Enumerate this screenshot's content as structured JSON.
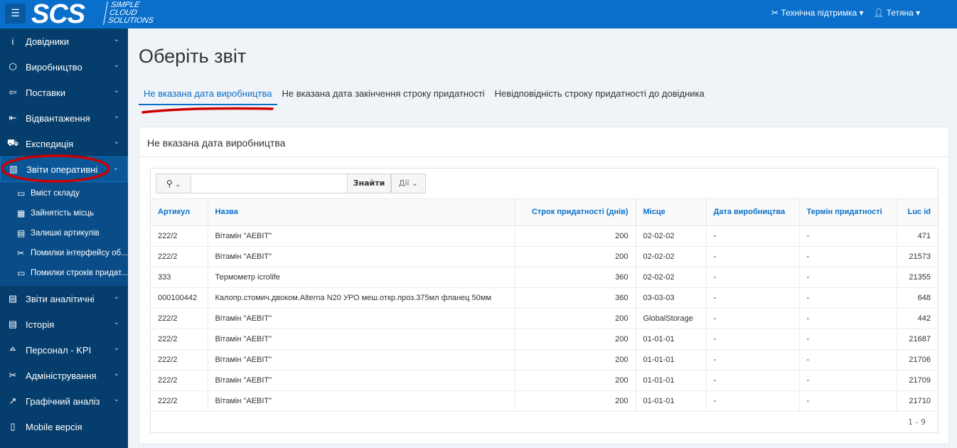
{
  "header": {
    "logo": "SCS",
    "logo_sub": [
      "SIMPLE",
      "CLOUD",
      "SOLUTIONS"
    ],
    "support": "Технічна підтримка",
    "user": "Тетяна"
  },
  "sidebar": {
    "items": [
      {
        "label": "Довідники",
        "icon": "info-icon"
      },
      {
        "label": "Виробництво",
        "icon": "box-icon"
      },
      {
        "label": "Поставки",
        "icon": "sign-in-icon"
      },
      {
        "label": "Відвантаження",
        "icon": "sign-out-icon"
      },
      {
        "label": "Експедиція",
        "icon": "truck-icon"
      },
      {
        "label": "Звіти оперативні",
        "icon": "bar-chart-icon",
        "active": true
      }
    ],
    "subitems": [
      {
        "label": "Вміст складу",
        "icon": "window-icon"
      },
      {
        "label": "Зайнятість місць",
        "icon": "grid-icon"
      },
      {
        "label": "Залишкі артикулів",
        "icon": "archive-icon"
      },
      {
        "label": "Помилки інтерфейсу об...",
        "icon": "tools-icon"
      },
      {
        "label": "Помилки строків придат...",
        "icon": "calendar-x-icon"
      }
    ],
    "items2": [
      {
        "label": "Звіти аналітичні",
        "icon": "report-icon"
      },
      {
        "label": "Історія",
        "icon": "archive-icon"
      },
      {
        "label": "Персонал - KPI",
        "icon": "people-icon"
      },
      {
        "label": "Адміністрування",
        "icon": "tools-icon"
      },
      {
        "label": "Графічний аналіз",
        "icon": "chart-icon"
      },
      {
        "label": "Mobile версія",
        "icon": "mobile-icon"
      }
    ]
  },
  "page": {
    "title": "Оберіть звіт",
    "tabs": [
      "Не вказана дата виробництва",
      "Не вказана дата закінчення строку придатності",
      "Невідповідність строку придатності до довідника"
    ],
    "panel_title": "Не вказана дата виробництва",
    "search": {
      "value": "",
      "find": "Знайти",
      "actions": "Дії"
    },
    "columns": [
      "Артикул",
      "Назва",
      "Строк придатності (днів)",
      "Місце",
      "Дата виробництва",
      "Термін придатності",
      "Luc id"
    ],
    "rows": [
      [
        "222/2",
        "Вітамін \"AEBIT\"",
        "200",
        "02-02-02",
        "-",
        "-",
        "471"
      ],
      [
        "222/2",
        "Вітамін \"AEBIT\"",
        "200",
        "02-02-02",
        "-",
        "-",
        "21573"
      ],
      [
        "333",
        "Термометр icrolife",
        "360",
        "02-02-02",
        "-",
        "-",
        "21355"
      ],
      [
        "000100442",
        "Калопр.стомич.двоком.Alterna N20 УРО меш.откр.проз.375мл фланец 50мм",
        "360",
        "03-03-03",
        "-",
        "-",
        "648"
      ],
      [
        "222/2",
        "Вітамін \"AEBIT\"",
        "200",
        "GlobalStorage",
        "-",
        "-",
        "442"
      ],
      [
        "222/2",
        "Вітамін \"AEBIT\"",
        "200",
        "01-01-01",
        "-",
        "-",
        "21687"
      ],
      [
        "222/2",
        "Вітамін \"AEBIT\"",
        "200",
        "01-01-01",
        "-",
        "-",
        "21706"
      ],
      [
        "222/2",
        "Вітамін \"AEBIT\"",
        "200",
        "01-01-01",
        "-",
        "-",
        "21709"
      ],
      [
        "222/2",
        "Вітамін \"AEBIT\"",
        "200",
        "01-01-01",
        "-",
        "-",
        "21710"
      ]
    ],
    "pagination": "1 - 9"
  },
  "colors": {
    "header": "#0a6fca",
    "sidebar": "#053d6c",
    "accent": "#0a6fca",
    "annotation": "#cc0000"
  }
}
